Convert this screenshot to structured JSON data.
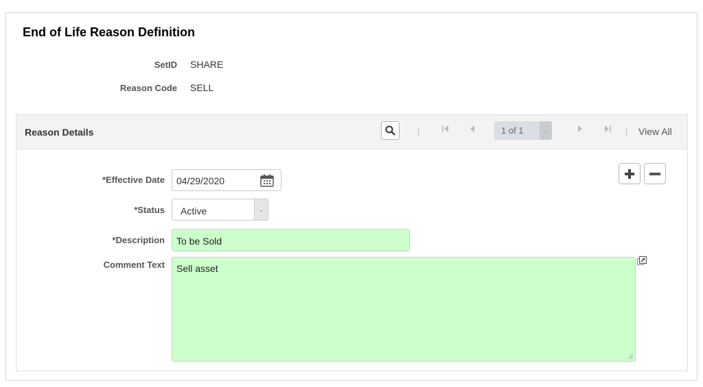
{
  "page": {
    "title": "End of Life Reason Definition"
  },
  "keys": {
    "setid_label": "SetID",
    "setid_value": "SHARE",
    "reason_code_label": "Reason Code",
    "reason_code_value": "SELL"
  },
  "panel": {
    "title": "Reason Details",
    "navigation": {
      "search_icon": "search-icon",
      "first_icon": "first-page-icon",
      "prev_icon": "previous-icon",
      "page_indicator": "1 of 1",
      "next_icon": "next-icon",
      "last_icon": "last-page-icon",
      "view_all_label": "View All"
    },
    "row_actions": {
      "add_icon": "plus-icon",
      "delete_icon": "minus-icon"
    },
    "fields": {
      "effective_date_label": "*Effective Date",
      "effective_date_value": "04/29/2020",
      "status_label": "*Status",
      "status_value": "Active",
      "description_label": "*Description",
      "description_value": "To be Sold",
      "comment_label": "Comment Text",
      "comment_value": "Sell asset"
    }
  },
  "colors": {
    "required_field_bg": "#ccffcc",
    "panel_header_bg": "#f3f3f3",
    "page_indicator_bg": "#d9dee4"
  }
}
